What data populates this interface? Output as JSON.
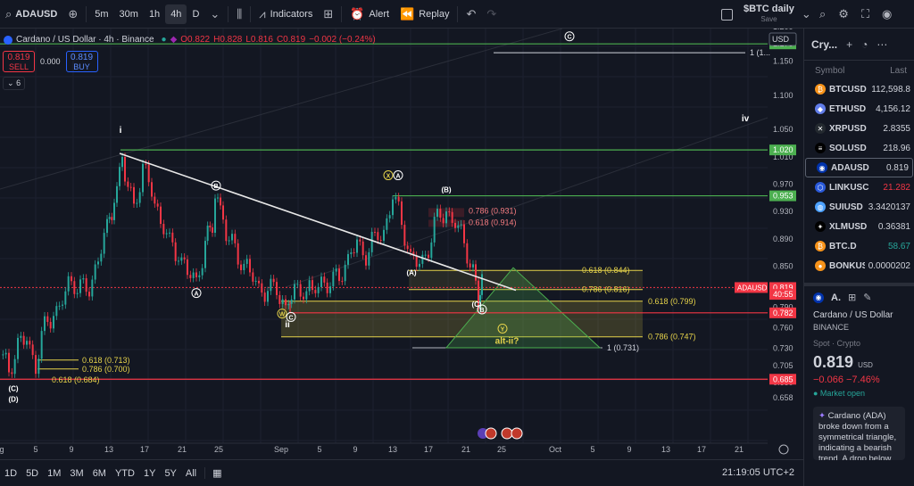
{
  "toolbar": {
    "symbol": "ADAUSD",
    "intervals": [
      "5m",
      "30m",
      "1h",
      "4h",
      "D"
    ],
    "active_interval": "4h",
    "indicators_label": "Indicators",
    "alert_label": "Alert",
    "replay_label": "Replay",
    "layout_name": "$BTC daily",
    "layout_save": "Save"
  },
  "legend": {
    "title": "Cardano / US Dollar · 4h · Binance",
    "open": "O0.822",
    "high": "H0.828",
    "low": "L0.816",
    "close": "C0.819",
    "change": "−0.002 (−0.24%)"
  },
  "trade": {
    "sell_price": "0.819",
    "sell_label": "SELL",
    "lot": "0.000",
    "buy_price": "0.819",
    "buy_label": "BUY",
    "collapse_count": "6"
  },
  "axis": {
    "currency": "USD",
    "ticks": [
      "1.200",
      "1.150",
      "1.100",
      "1.050",
      "1.010",
      "0.970",
      "0.930",
      "0.890",
      "0.850",
      "0.790",
      "0.760",
      "0.730",
      "0.705",
      "0.680",
      "0.658"
    ],
    "badges": [
      {
        "label": "1.175",
        "color": "#4caf50"
      },
      {
        "label": "1.020",
        "color": "#4caf50"
      },
      {
        "label": "0.953",
        "color": "#4caf50"
      },
      {
        "label": "0.819",
        "color": "#f23645"
      },
      {
        "label": "40:55",
        "color": "#f23645"
      },
      {
        "label": "0.782",
        "color": "#f23645"
      },
      {
        "label": "0.685",
        "color": "#f23645"
      }
    ],
    "price_tag_symbol": "ADAUSD",
    "x_labels": [
      "g",
      "5",
      "9",
      "13",
      "17",
      "21",
      "25",
      "Sep",
      "5",
      "9",
      "13",
      "17",
      "21",
      "25",
      "Oct",
      "5",
      "9",
      "13",
      "17",
      "21"
    ]
  },
  "annotations": {
    "fib_top_right": "1 (1...",
    "fib_0618_844": "0.618 (0.844)",
    "fib_0786_816": "0.786 (0.816)",
    "fib_0618_799": "0.618 (0.799)",
    "fib_0786_747": "0.786 (0.747)",
    "fib_1_731": "1 (0.731)",
    "fib_0786_931": "0.786 (0.931)",
    "fib_0618_914": "0.618 (0.914)",
    "fib_0618_713": "0.618 (0.713)",
    "fib_0786_700": "0.786 (0.700)",
    "fib_0618_684": "0.618 (0.684)",
    "wave_i": "i",
    "wave_ii": "ii",
    "wave_iv": "iv",
    "wave_B1": "B",
    "wave_A1": "A",
    "wave_X": "X",
    "wave_A2": "A",
    "wave_B2": "(B)",
    "wave_A3": "(A)",
    "wave_C1": "(C)",
    "wave_B3": "B",
    "wave_W": "W",
    "wave_C2": "C",
    "wave_Y": "Y",
    "wave_C_bottom": "(C)",
    "wave_D_bottom": "(D)",
    "wave_C_top": "C",
    "alt_ii": "alt-ii?"
  },
  "bottombar": {
    "ranges": [
      "1D",
      "5D",
      "1M",
      "3M",
      "6M",
      "YTD",
      "1Y",
      "5Y",
      "All"
    ],
    "time": "21:19:05 UTC+2"
  },
  "watchlist": {
    "title": "Cry...",
    "col_symbol": "Symbol",
    "col_last": "Last",
    "items": [
      {
        "symbol": "BTCUSD",
        "last": "112,598.8",
        "color": "#f7931a",
        "glyph": "₿",
        "cls": ""
      },
      {
        "symbol": "ETHUSD",
        "last": "4,156.12",
        "color": "#627eea",
        "glyph": "◆",
        "cls": ""
      },
      {
        "symbol": "XRPUSD",
        "last": "2.8355",
        "color": "#23292f",
        "glyph": "✕",
        "cls": ""
      },
      {
        "symbol": "SOLUSD",
        "last": "218.96",
        "color": "#000000",
        "glyph": "≡",
        "cls": ""
      },
      {
        "symbol": "ADAUSD",
        "last": "0.819",
        "color": "#0033ad",
        "glyph": "◉",
        "cls": ""
      },
      {
        "symbol": "LINKUSC",
        "last": "21.282",
        "color": "#2a5ada",
        "glyph": "⬡",
        "cls": "neg"
      },
      {
        "symbol": "SUIUSD",
        "last": "3.3420137",
        "color": "#4da2ff",
        "glyph": "◍",
        "cls": ""
      },
      {
        "symbol": "XLMUSD",
        "last": "0.36381",
        "color": "#000000",
        "glyph": "✦",
        "cls": ""
      },
      {
        "symbol": "BTC.D",
        "last": "58.67",
        "color": "#f7931a",
        "glyph": "₿",
        "cls": "pos"
      },
      {
        "symbol": "BONKUS",
        "last": "0.0000202",
        "color": "#f7931a",
        "glyph": "●",
        "cls": ""
      }
    ]
  },
  "detail": {
    "short": "A.",
    "name": "Cardano / US Dollar",
    "exchange": "BINANCE",
    "type": "Spot · Crypto",
    "price": "0.819",
    "currency": "USD",
    "change": "−0.066  −7.46%",
    "market": "● Market open",
    "news": "Cardano (ADA) broke down from a symmetrical triangle, indicating a bearish trend. A drop below $0.78 may lead to $0.68, while a rise above"
  },
  "colors": {
    "bg": "#131722",
    "up": "#26a69a",
    "down": "#f23645",
    "green_line": "#4caf50",
    "yellow": "#e6d34a"
  }
}
